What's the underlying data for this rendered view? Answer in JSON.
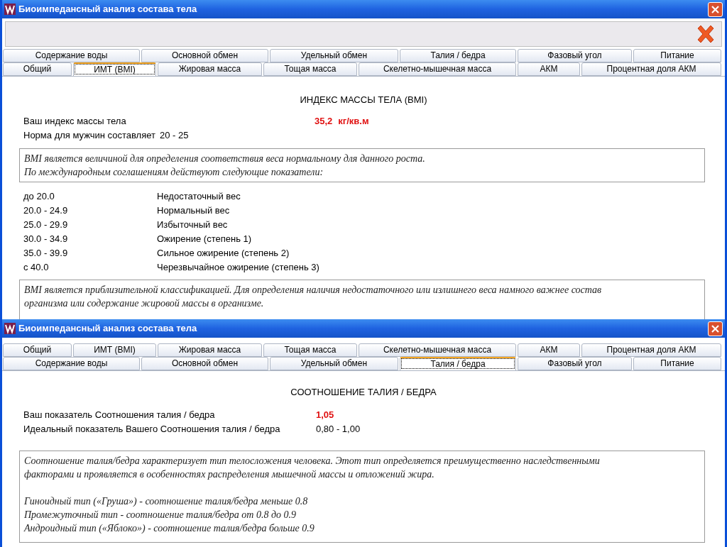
{
  "windows": [
    {
      "title": "Биоимпедансный анализ состава тела",
      "kind": "bmi",
      "toolbar": true,
      "tab_rows": [
        [
          {
            "label": "Содержание воды",
            "selected": false
          },
          {
            "label": "Основной обмен",
            "selected": false
          },
          {
            "label": "Удельный обмен",
            "selected": false
          },
          {
            "label": "Талия / бедра",
            "selected": false
          },
          {
            "label": "Фазовый угол",
            "selected": false
          },
          {
            "label": "Питание",
            "selected": false
          }
        ],
        [
          {
            "label": "Общий",
            "selected": false
          },
          {
            "label": "ИМТ (BMI)",
            "selected": true
          },
          {
            "label": "Жировая масса",
            "selected": false
          },
          {
            "label": "Тощая масса",
            "selected": false
          },
          {
            "label": "Скелетно-мышечная масса",
            "selected": false
          },
          {
            "label": "АКМ",
            "selected": false
          },
          {
            "label": "Процентная доля АКМ",
            "selected": false
          }
        ]
      ],
      "heading": "ИНДЕКС МАССЫ ТЕЛА (BMI)",
      "result": {
        "label": "Ваш индекс массы тела",
        "value": "35,2",
        "unit": "кг/кв.м"
      },
      "norm": {
        "label": "Норма для мужчин составляет",
        "value": "20 - 25"
      },
      "note": [
        [
          "BMI является величиной для определения соответствия веса нормальному для данного роста.",
          "По международным соглашениям действуют следующие показатели:"
        ]
      ],
      "classes": [
        {
          "range": "до 20.0",
          "label": "Недостаточный вес"
        },
        {
          "range": "20.0 - 24.9",
          "label": "Нормальный вес"
        },
        {
          "range": "25.0 - 29.9",
          "label": "Избыточный вес"
        },
        {
          "range": "30.0 - 34.9",
          "label": "Ожирение (степень 1)"
        },
        {
          "range": "35.0 - 39.9",
          "label": "Сильное ожирение (степень 2)"
        },
        {
          "range": "с 40.0",
          "label": "Черезвычайное ожирение (степень 3)"
        }
      ],
      "note2": [
        [
          "BMI является приблизительной классификацией. Для определения наличия недостаточного или излишнего веса намного важнее состав",
          "организма или содержание жировой массы в организме."
        ]
      ]
    },
    {
      "title": "Биоимпедансный анализ состава тела",
      "kind": "whr",
      "toolbar": false,
      "tab_rows": [
        [
          {
            "label": "Общий",
            "selected": false
          },
          {
            "label": "ИМТ (BMI)",
            "selected": false
          },
          {
            "label": "Жировая масса",
            "selected": false
          },
          {
            "label": "Тощая масса",
            "selected": false
          },
          {
            "label": "Скелетно-мышечная масса",
            "selected": false
          },
          {
            "label": "АКМ",
            "selected": false
          },
          {
            "label": "Процентная доля АКМ",
            "selected": false
          }
        ],
        [
          {
            "label": "Содержание воды",
            "selected": false
          },
          {
            "label": "Основной обмен",
            "selected": false
          },
          {
            "label": "Удельный обмен",
            "selected": false
          },
          {
            "label": "Талия / бедра",
            "selected": true
          },
          {
            "label": "Фазовый угол",
            "selected": false
          },
          {
            "label": "Питание",
            "selected": false
          }
        ]
      ],
      "heading": "СООТНОШЕНИЕ ТАЛИЯ / БЕДРА",
      "result": {
        "label": "Ваш показатель Соотношения талия / бедра",
        "value": "1,05"
      },
      "norm": {
        "label": "Идеальный показатель Вашего Соотношения талия / бедра",
        "value": "0,80 - 1,00"
      },
      "note": [
        [
          "Соотношение талия/бедра характеризует тип телосложения человека. Этот тип определяется преимущественно наследственными",
          "факторами и проявляется в особенностях распределения мышечной массы и отложений жира."
        ],
        [
          "Гиноидный тип («Груша») - соотношение талия/бедра меньше 0.8",
          "Промежуточный тип - соотношение талия/бедра от 0.8 до 0.9",
          "Андроидный тип («Яблоко») - соотношение талия/бедра больше 0.9"
        ]
      ]
    }
  ]
}
